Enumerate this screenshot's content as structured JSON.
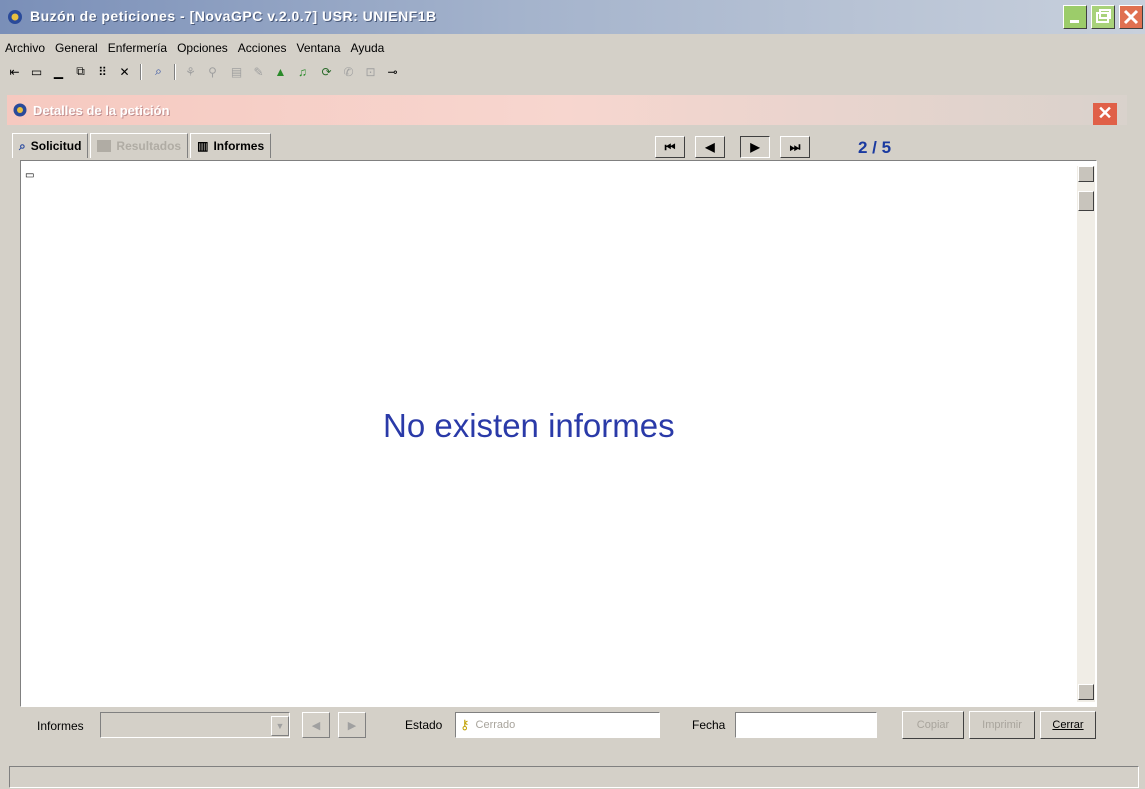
{
  "window": {
    "title": "Buzón de peticiones - [NovaGPC v.2.0.7] USR: UNIENF1B"
  },
  "menu": [
    "Archivo",
    "General",
    "Enfermería",
    "Opciones",
    "Acciones",
    "Ventana",
    "Ayuda"
  ],
  "toolbar_icons": [
    {
      "name": "exit-icon",
      "glyph": "⇤",
      "enabled": true
    },
    {
      "name": "window-icon",
      "glyph": "▭",
      "enabled": true
    },
    {
      "name": "minimize-icon",
      "glyph": "▁",
      "enabled": true
    },
    {
      "name": "cascade-icon",
      "glyph": "⧉",
      "enabled": true
    },
    {
      "name": "tile-icon",
      "glyph": "⠿",
      "enabled": true
    },
    {
      "name": "close-icon",
      "glyph": "✕",
      "enabled": true
    },
    {
      "name": "search-icon",
      "glyph": "🔍",
      "enabled": true
    },
    {
      "name": "tool-icon-1",
      "glyph": "⚘",
      "enabled": false
    },
    {
      "name": "tool-icon-2",
      "glyph": "⚲",
      "enabled": false
    },
    {
      "name": "tool-icon-3",
      "glyph": "▤",
      "enabled": false
    },
    {
      "name": "tool-icon-4",
      "glyph": "✎",
      "enabled": false
    },
    {
      "name": "tool-icon-5",
      "glyph": "▲",
      "enabled": true
    },
    {
      "name": "bell-icon",
      "glyph": "🔔",
      "enabled": true
    },
    {
      "name": "refresh-icon",
      "glyph": "⟳",
      "enabled": true
    },
    {
      "name": "tool-icon-6",
      "glyph": "✆",
      "enabled": false
    },
    {
      "name": "lock-icon",
      "glyph": "🔒",
      "enabled": false
    },
    {
      "name": "key-icon",
      "glyph": "⊸",
      "enabled": true
    }
  ],
  "dialog": {
    "title": "Detalles de la petición",
    "tabs": [
      {
        "label": "Solicitud",
        "icon": "search-icon",
        "enabled": true
      },
      {
        "label": "Resultados",
        "icon": "results-icon",
        "enabled": false
      },
      {
        "label": "Informes",
        "icon": "book-icon",
        "enabled": true
      }
    ],
    "pager": "2 / 5",
    "empty_message": "No existen informes",
    "informes_label": "Informes",
    "estado_label": "Estado",
    "estado_value": "Cerrado",
    "fecha_label": "Fecha",
    "fecha_value": "",
    "buttons": {
      "copiar": "Copiar",
      "imprimir": "Imprimir",
      "cerrar": "Cerrar"
    }
  }
}
